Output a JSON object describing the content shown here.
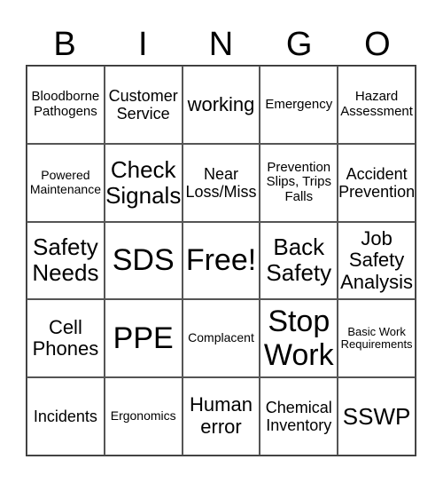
{
  "header": {
    "letters": [
      "B",
      "I",
      "N",
      "G",
      "O"
    ]
  },
  "card": {
    "rows": [
      [
        {
          "text": "Bloodborne Pathogens",
          "size": "s"
        },
        {
          "text": "Customer Service",
          "size": "m"
        },
        {
          "text": "working",
          "size": "l"
        },
        {
          "text": "Emergency",
          "size": "s"
        },
        {
          "text": "Hazard Assessment",
          "size": "s"
        }
      ],
      [
        {
          "text": "Powered Maintenance",
          "size": "xs"
        },
        {
          "text": "Check Signals",
          "size": "xl"
        },
        {
          "text": "Near Loss/Miss",
          "size": "m"
        },
        {
          "text": "Prevention Slips, Trips Falls",
          "size": "s"
        },
        {
          "text": "Accident Prevention",
          "size": "m"
        }
      ],
      [
        {
          "text": "Safety Needs",
          "size": "xl"
        },
        {
          "text": "SDS",
          "size": "xxl"
        },
        {
          "text": "Free!",
          "size": "xxl"
        },
        {
          "text": "Back Safety",
          "size": "xl"
        },
        {
          "text": "Job Safety Analysis",
          "size": "l"
        }
      ],
      [
        {
          "text": "Cell Phones",
          "size": "l"
        },
        {
          "text": "PPE",
          "size": "xxl"
        },
        {
          "text": "Complacent",
          "size": "xs"
        },
        {
          "text": "Stop Work",
          "size": "xxl"
        },
        {
          "text": "Basic Work Requirements",
          "size": "xxs"
        }
      ],
      [
        {
          "text": "Incidents",
          "size": "m"
        },
        {
          "text": "Ergonomics",
          "size": "xs"
        },
        {
          "text": "Human error",
          "size": "l"
        },
        {
          "text": "Chemical Inventory",
          "size": "m"
        },
        {
          "text": "SSWP",
          "size": "xl"
        }
      ]
    ]
  }
}
